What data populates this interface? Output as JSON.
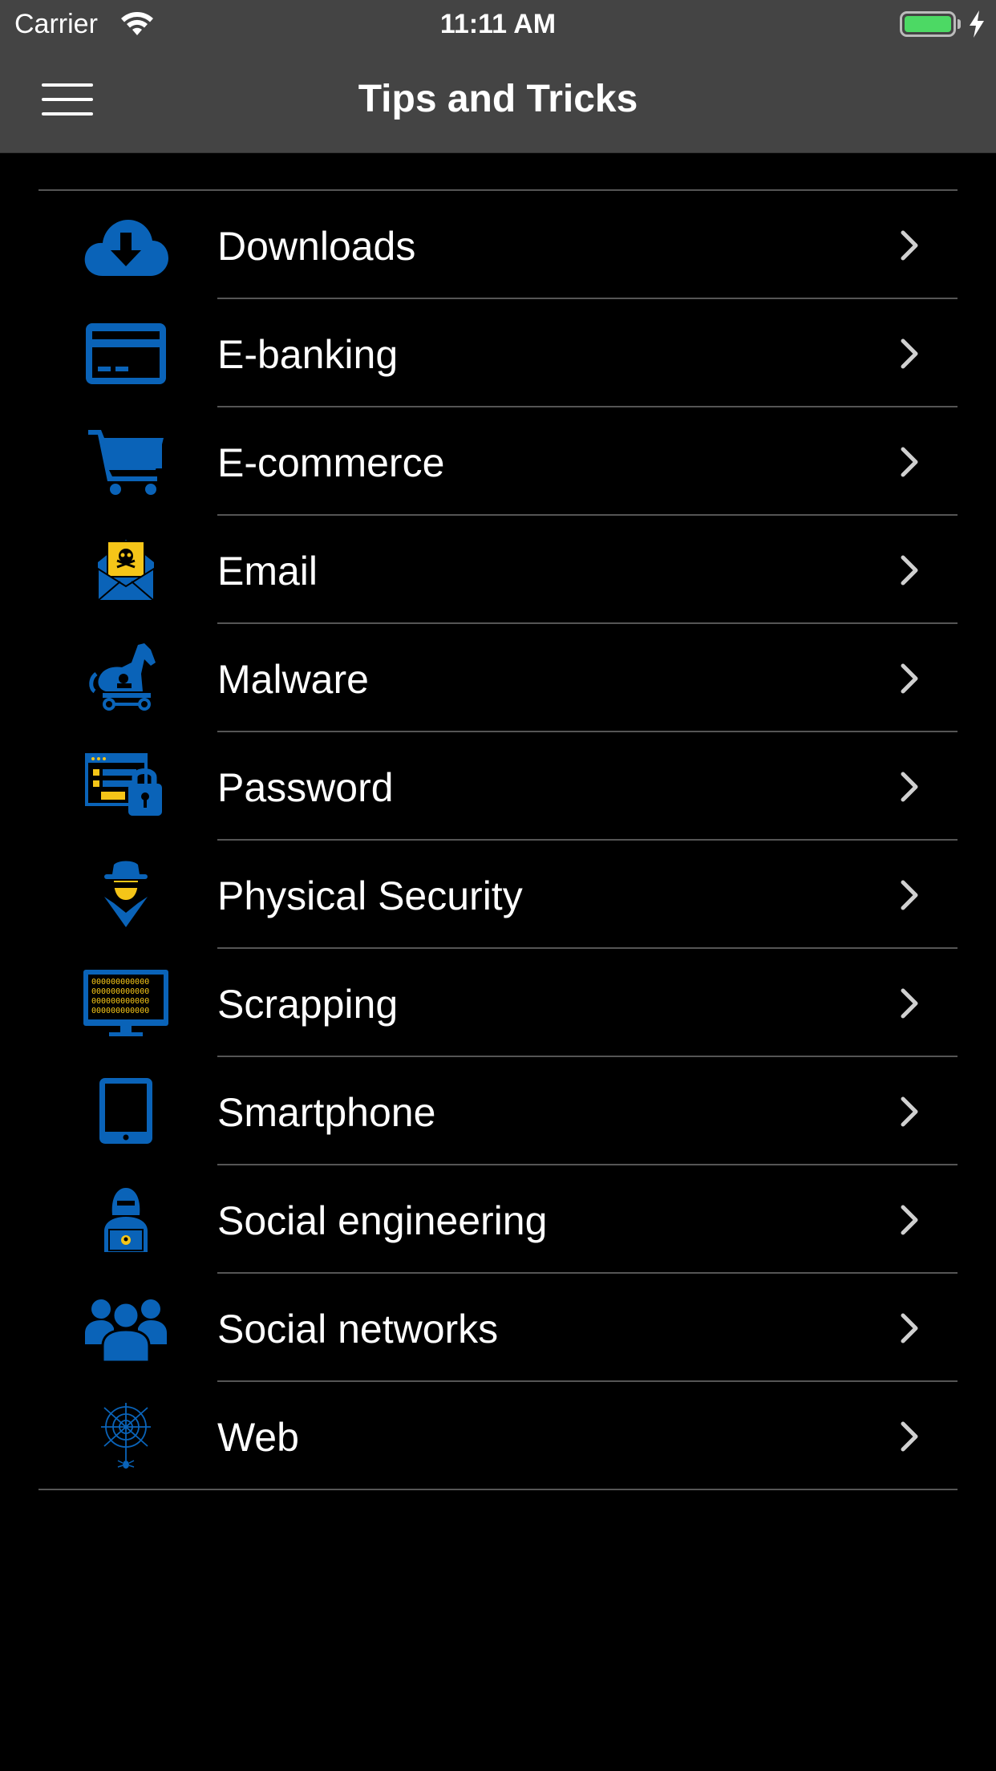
{
  "status_bar": {
    "carrier": "Carrier",
    "time": "11:11 AM",
    "wifi_icon": "wifi-icon",
    "battery_icon": "battery-icon",
    "charging_icon": "charging-bolt-icon",
    "battery_color": "#4cd964"
  },
  "nav_bar": {
    "title": "Tips and Tricks",
    "menu_icon": "hamburger-menu-icon",
    "background": "#444444"
  },
  "accent_color": "#0a63b8",
  "highlight_color": "#f5c518",
  "list": {
    "items": [
      {
        "label": "Downloads",
        "icon": "cloud-download-icon"
      },
      {
        "label": "E-banking",
        "icon": "credit-card-icon"
      },
      {
        "label": "E-commerce",
        "icon": "shopping-cart-icon"
      },
      {
        "label": "Email",
        "icon": "email-skull-icon"
      },
      {
        "label": "Malware",
        "icon": "trojan-horse-icon"
      },
      {
        "label": "Password",
        "icon": "login-lock-icon"
      },
      {
        "label": "Physical Security",
        "icon": "spy-icon"
      },
      {
        "label": "Scrapping",
        "icon": "binary-monitor-icon"
      },
      {
        "label": "Smartphone",
        "icon": "tablet-icon"
      },
      {
        "label": "Social engineering",
        "icon": "hacker-laptop-icon"
      },
      {
        "label": "Social networks",
        "icon": "people-group-icon"
      },
      {
        "label": "Web",
        "icon": "spider-web-icon"
      }
    ],
    "chevron_icon": "chevron-right-icon"
  }
}
